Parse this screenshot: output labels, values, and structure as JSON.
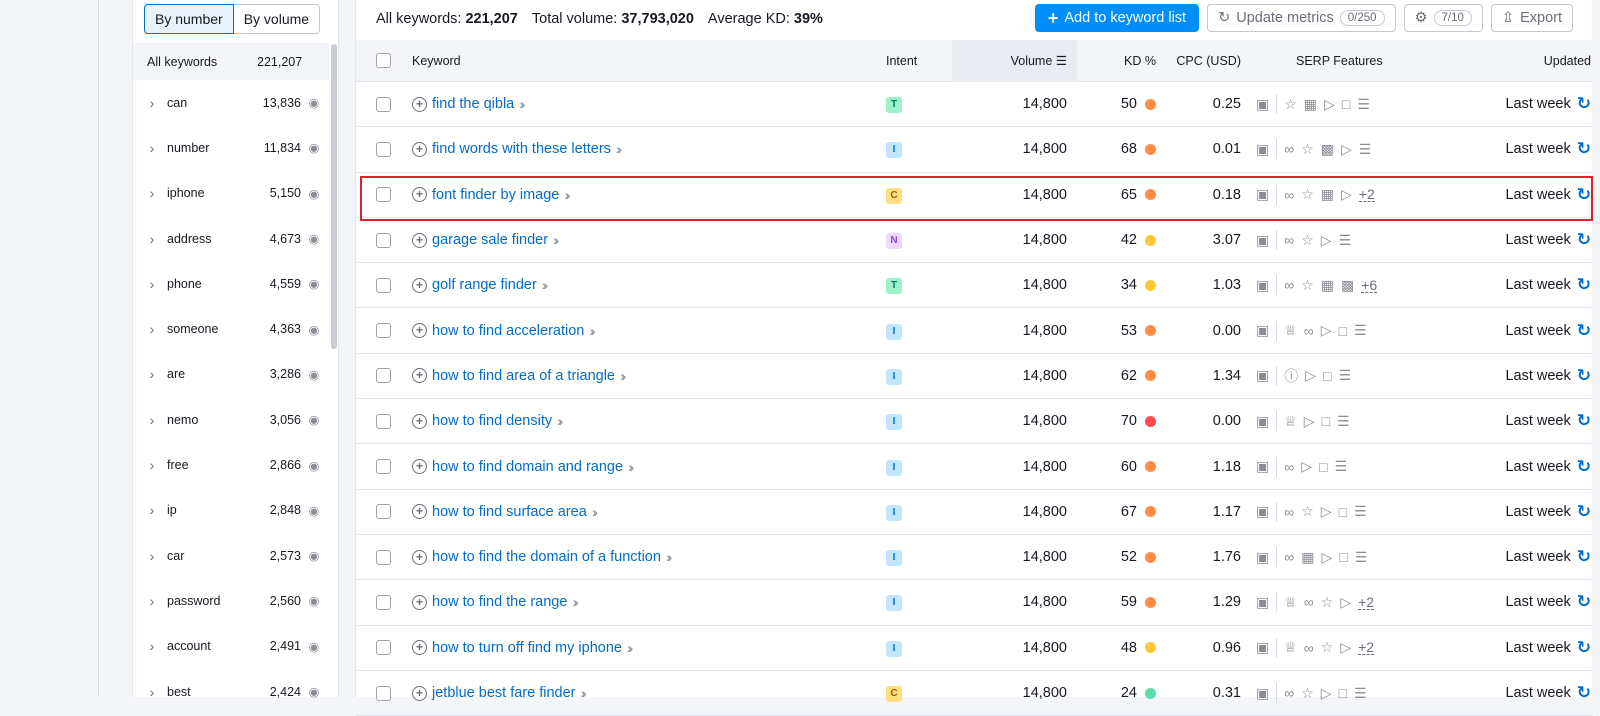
{
  "sidebar": {
    "toggle": [
      "By number",
      "By volume"
    ],
    "all_label": "All keywords",
    "all_count": "221,207",
    "items": [
      {
        "word": "can",
        "count": "13,836"
      },
      {
        "word": "number",
        "count": "11,834"
      },
      {
        "word": "iphone",
        "count": "5,150"
      },
      {
        "word": "address",
        "count": "4,673"
      },
      {
        "word": "phone",
        "count": "4,559"
      },
      {
        "word": "someone",
        "count": "4,363"
      },
      {
        "word": "are",
        "count": "3,286"
      },
      {
        "word": "nemo",
        "count": "3,056"
      },
      {
        "word": "free",
        "count": "2,866"
      },
      {
        "word": "ip",
        "count": "2,848"
      },
      {
        "word": "car",
        "count": "2,573"
      },
      {
        "word": "password",
        "count": "2,560"
      },
      {
        "word": "account",
        "count": "2,491"
      },
      {
        "word": "best",
        "count": "2,424"
      }
    ]
  },
  "summary": {
    "all_label": "All keywords:",
    "all_value": "221,207",
    "vol_label": "Total volume:",
    "vol_value": "37,793,020",
    "kd_label": "Average KD:",
    "kd_value": "39%"
  },
  "actions": {
    "add": "Add to keyword list",
    "update": "Update metrics",
    "update_count": "0/250",
    "settings_count": "7/10",
    "export": "Export"
  },
  "columns": [
    "Keyword",
    "Intent",
    "Volume",
    "KD %",
    "CPC (USD)",
    "SERP Features",
    "Updated"
  ],
  "colors": {
    "accent": "#008ff8",
    "link": "#006dca",
    "orange": "#ff8c42",
    "yellow": "#ffc935",
    "red": "#ff4953",
    "green": "#59ddaa",
    "highlight": "#e0202a"
  },
  "rows": [
    {
      "kw": "find the qibla",
      "intent": "T",
      "vol": "14,800",
      "kd": "50",
      "kdc": "orange",
      "cpc": "0.25",
      "serp": [
        "sl",
        "sep",
        "star",
        "img",
        "play",
        "faq",
        "list"
      ],
      "upd": "Last week"
    },
    {
      "kw": "find words with these letters",
      "intent": "I",
      "vol": "14,800",
      "kd": "68",
      "kdc": "orange",
      "cpc": "0.01",
      "serp": [
        "sl",
        "sep",
        "link",
        "star",
        "img2",
        "play",
        "list"
      ],
      "upd": "Last week"
    },
    {
      "kw": "font finder by image",
      "intent": "C",
      "vol": "14,800",
      "kd": "65",
      "kdc": "orange",
      "cpc": "0.18",
      "serp": [
        "sl",
        "sep",
        "link",
        "star",
        "img",
        "play"
      ],
      "more": "+2",
      "upd": "Last week"
    },
    {
      "kw": "garage sale finder",
      "intent": "N",
      "vol": "14,800",
      "kd": "42",
      "kdc": "yellow",
      "cpc": "3.07",
      "serp": [
        "sl",
        "sep",
        "link",
        "star",
        "play",
        "list"
      ],
      "upd": "Last week"
    },
    {
      "kw": "golf range finder",
      "intent": "T",
      "vol": "14,800",
      "kd": "34",
      "kdc": "yellow",
      "cpc": "1.03",
      "serp": [
        "sl",
        "sep",
        "link",
        "star",
        "img",
        "img2"
      ],
      "more": "+6",
      "upd": "Last week"
    },
    {
      "kw": "how to find acceleration",
      "intent": "I",
      "vol": "14,800",
      "kd": "53",
      "kdc": "orange",
      "cpc": "0.00",
      "serp": [
        "sl",
        "sep",
        "crown",
        "link",
        "play",
        "faq",
        "list"
      ],
      "upd": "Last week"
    },
    {
      "kw": "how to find area of a triangle",
      "intent": "I",
      "vol": "14,800",
      "kd": "62",
      "kdc": "orange",
      "cpc": "1.34",
      "serp": [
        "sl",
        "sep",
        "q",
        "play",
        "faq",
        "list"
      ],
      "upd": "Last week"
    },
    {
      "kw": "how to find density",
      "intent": "I",
      "vol": "14,800",
      "kd": "70",
      "kdc": "red",
      "cpc": "0.00",
      "serp": [
        "sl",
        "sep",
        "crown",
        "play",
        "faq",
        "list"
      ],
      "upd": "Last week"
    },
    {
      "kw": "how to find domain and range",
      "intent": "I",
      "vol": "14,800",
      "kd": "60",
      "kdc": "orange",
      "cpc": "1.18",
      "serp": [
        "sl",
        "sep",
        "link",
        "play",
        "faq",
        "list"
      ],
      "upd": "Last week"
    },
    {
      "kw": "how to find surface area",
      "intent": "I",
      "vol": "14,800",
      "kd": "67",
      "kdc": "orange",
      "cpc": "1.17",
      "serp": [
        "sl",
        "sep",
        "link",
        "star",
        "play",
        "faq",
        "list"
      ],
      "upd": "Last week"
    },
    {
      "kw": "how to find the domain of a function",
      "intent": "I",
      "vol": "14,800",
      "kd": "52",
      "kdc": "orange",
      "cpc": "1.76",
      "serp": [
        "sl",
        "sep",
        "link",
        "img",
        "play",
        "faq",
        "list"
      ],
      "upd": "Last week"
    },
    {
      "kw": "how to find the range",
      "intent": "I",
      "vol": "14,800",
      "kd": "59",
      "kdc": "orange",
      "cpc": "1.29",
      "serp": [
        "sl",
        "sep",
        "crown",
        "link",
        "star",
        "play"
      ],
      "more": "+2",
      "upd": "Last week"
    },
    {
      "kw": "how to turn off find my iphone",
      "intent": "I",
      "vol": "14,800",
      "kd": "48",
      "kdc": "yellow",
      "cpc": "0.96",
      "serp": [
        "sl",
        "sep",
        "crown",
        "link",
        "star",
        "play"
      ],
      "more": "+2",
      "upd": "Last week"
    },
    {
      "kw": "jetblue best fare finder",
      "intent": "C",
      "vol": "14,800",
      "kd": "24",
      "kdc": "green",
      "cpc": "0.31",
      "serp": [
        "sl",
        "sep",
        "link",
        "star",
        "play",
        "faq",
        "list"
      ],
      "upd": "Last week"
    }
  ]
}
